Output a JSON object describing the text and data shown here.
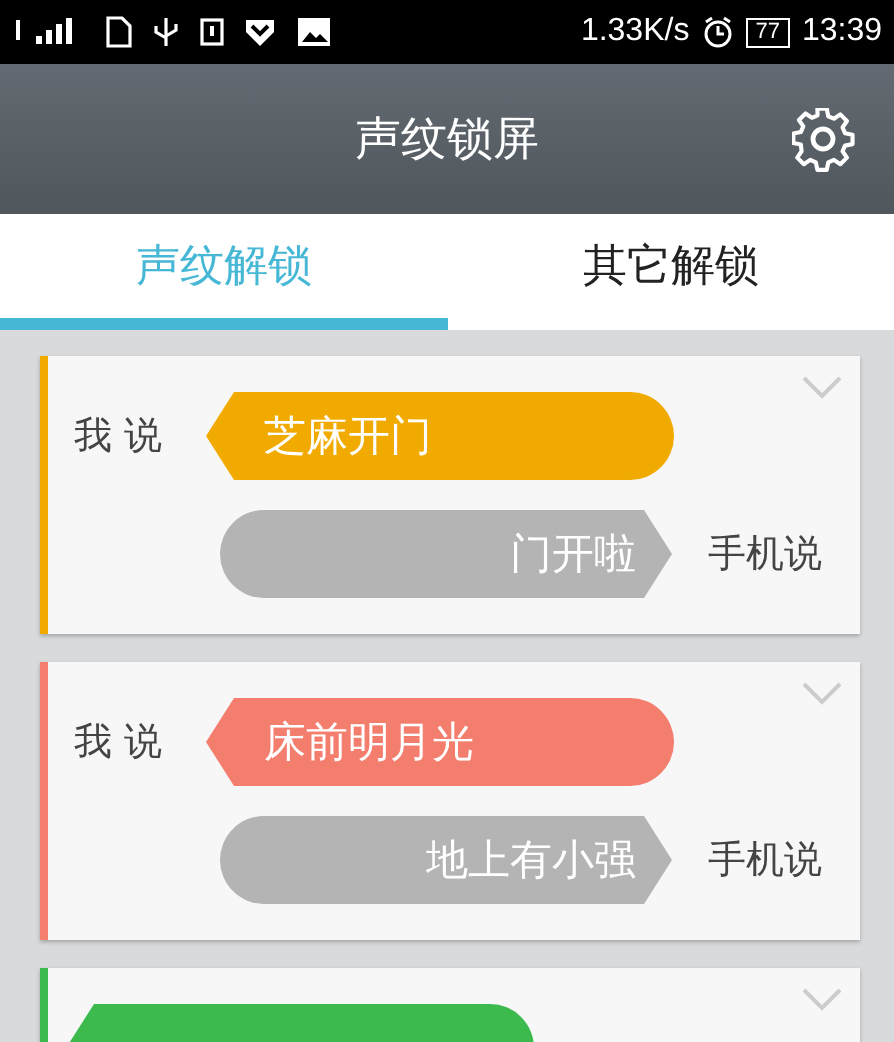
{
  "status_bar": {
    "speed": "1.33K/s",
    "battery": "77",
    "time": "13:39"
  },
  "header": {
    "title": "声纹锁屏"
  },
  "tabs": [
    {
      "label": "声纹解锁",
      "selected": true
    },
    {
      "label": "其它解锁",
      "selected": false
    }
  ],
  "cards": [
    {
      "color": "#f0aa00",
      "me_label": "我 说",
      "me_phrase": "芝麻开门",
      "phone_phrase": "门开啦",
      "phone_label": "手机说"
    },
    {
      "color": "#f47e6e",
      "me_label": "我 说",
      "me_phrase": "床前明月光",
      "phone_phrase": "地上有小强",
      "phone_label": "手机说"
    },
    {
      "color": "#3dba4e"
    }
  ]
}
